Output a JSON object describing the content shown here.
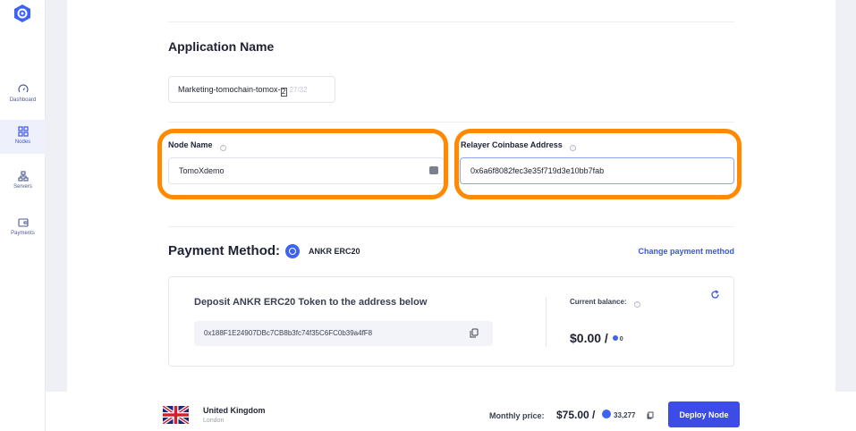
{
  "sidebar": {
    "items": [
      {
        "label": "Dashboard",
        "icon": "gauge-icon"
      },
      {
        "label": "Nodes",
        "icon": "grid-icon",
        "active": true
      },
      {
        "label": "Servers",
        "icon": "servers-icon"
      },
      {
        "label": "Payments",
        "icon": "wallet-icon"
      }
    ]
  },
  "app_name": {
    "title": "Application Name",
    "value": "Marketing-tomochain-tomox-",
    "cursor_char": "2",
    "counter": "27/32"
  },
  "node_name": {
    "label": "Node Name",
    "value": "TomoXdemo"
  },
  "relayer": {
    "label": "Relayer Coinbase Address",
    "value": "0x6a6f8082fec3e35f719d3e10bb7fab"
  },
  "payment": {
    "title": "Payment Method:",
    "token": "ANKR ERC20",
    "change_link": "Change payment method"
  },
  "deposit": {
    "title": "Deposit ANKR ERC20 Token to the address below",
    "address": "0x188F1E24907DBc7CB8b3fc74f35C6FC0b39a4fF8",
    "balance_label": "Current balance:",
    "balance_usd": "$0.00 /",
    "balance_token": "0"
  },
  "footer": {
    "country": "United Kingdom",
    "city": "London",
    "price_label": "Monthly price:",
    "price_usd": "$75.00 /",
    "price_ankr": "33,277",
    "deploy_label": "Deploy Node"
  },
  "colors": {
    "accent": "#3d4ce6",
    "highlight": "#ff8a00"
  }
}
